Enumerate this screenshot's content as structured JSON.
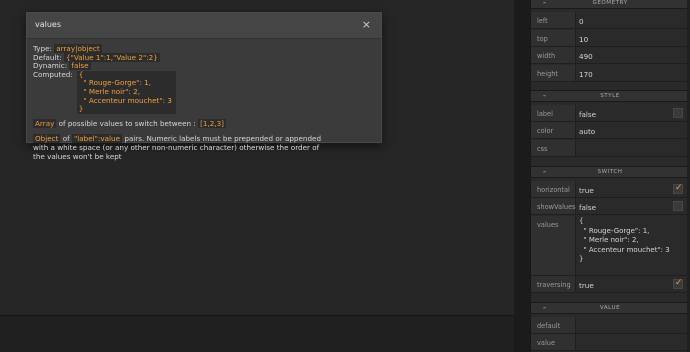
{
  "dialog": {
    "title": "values",
    "close_glyph": "×",
    "type_label": "Type:",
    "type_value": "array|object",
    "default_label": "Default:",
    "default_value": "{\"Value 1\":1,\"Value 2\":2}",
    "dynamic_label": "Dynamic:",
    "dynamic_value": "false",
    "computed_label": "Computed:",
    "computed_value": "{\n  \" Rouge-Gorge\": 1,\n  \" Merle noir\": 2,\n  \" Accenteur mouchet\": 3\n}",
    "array_word": "Array",
    "array_text": "of possible values to switch between :",
    "array_example": "[1,2,3]",
    "object_word": "Object",
    "object_of": "of",
    "object_label_value": "\"label\":value",
    "object_text": "pairs. Numeric labels must be prepended or appended with a white space (or any other non-numeric character) otherwise the order of the values won't be kept"
  },
  "panel": {
    "geometry": {
      "title": "GEOMETRY",
      "collapse_glyph": "-",
      "rows": [
        {
          "label": "left",
          "value": "0"
        },
        {
          "label": "top",
          "value": "10"
        },
        {
          "label": "width",
          "value": "490"
        },
        {
          "label": "height",
          "value": "170"
        }
      ]
    },
    "style": {
      "title": "STYLE",
      "collapse_glyph": "-",
      "label_label": "label",
      "label_value": "false",
      "color_label": "color",
      "color_value": "auto",
      "css_label": "css",
      "css_value": ""
    },
    "switch": {
      "title": "SWITCH",
      "collapse_glyph": "-",
      "horizontal_label": "horizontal",
      "horizontal_value": "true",
      "showvalues_label": "showValues",
      "showvalues_value": "false",
      "values_label": "values",
      "values_value": "{\n  \" Rouge-Gorge\": 1,\n  \" Merle noir\": 2,\n  \" Accenteur mouchet\": 3\n}",
      "traversing_label": "traversing",
      "traversing_value": "true"
    },
    "value": {
      "title": "VALUE",
      "collapse_glyph": "-",
      "default_label": "default",
      "default_value": "",
      "value_label": "value",
      "value_value": ""
    }
  },
  "colors": {
    "accent": "#f0a040",
    "background": "#232323",
    "panel": "#2a2a2a"
  }
}
